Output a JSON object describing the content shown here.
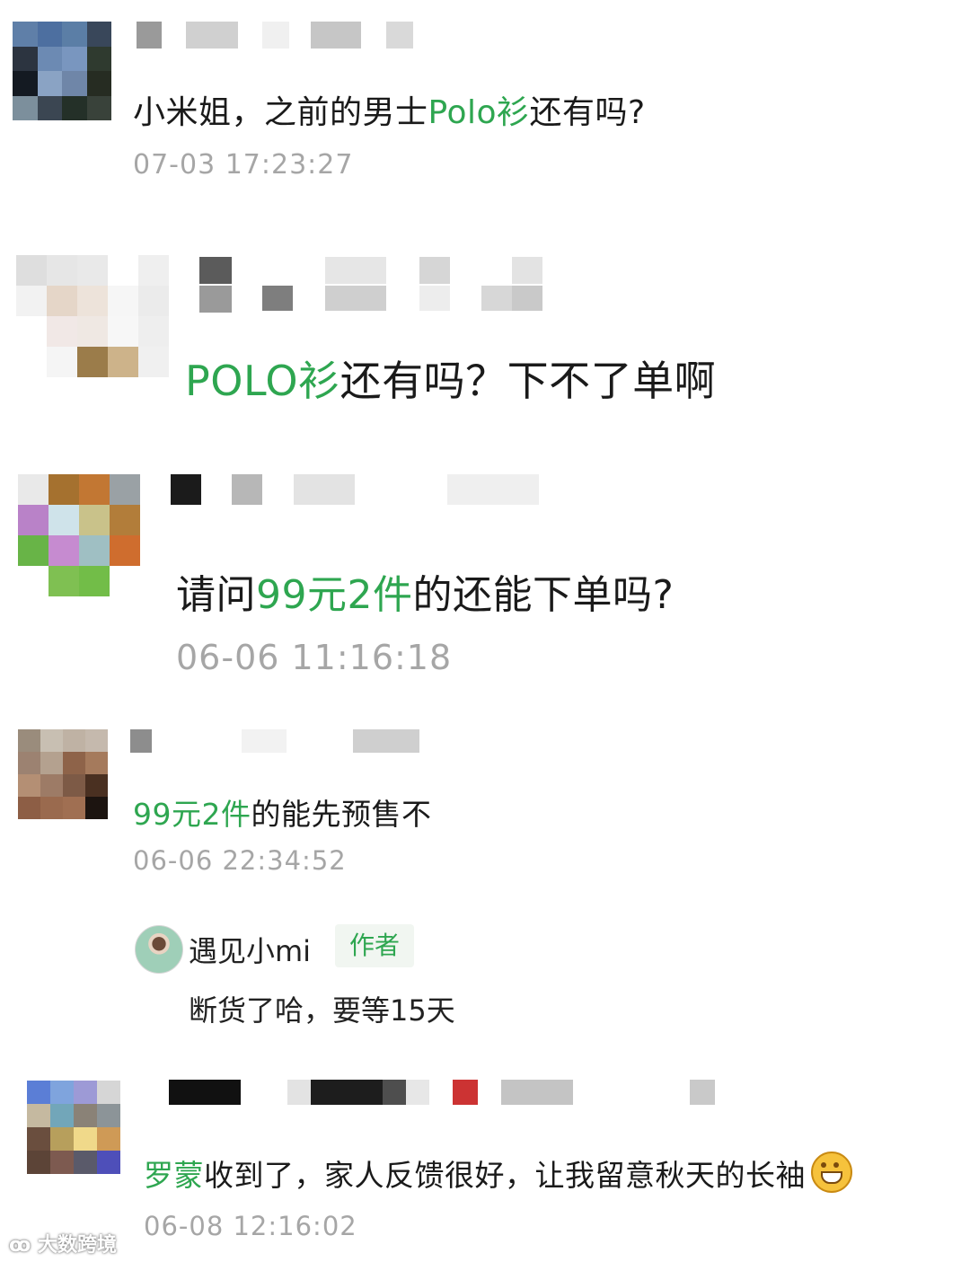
{
  "comments": [
    {
      "parts": [
        {
          "text": "小米姐，之前的男士",
          "highlight": false
        },
        {
          "text": "Polo衫",
          "highlight": true
        },
        {
          "text": "还有吗?",
          "highlight": false
        }
      ],
      "time": "07-03 17:23:27"
    },
    {
      "parts": [
        {
          "text": "POLO衫",
          "highlight": true
        },
        {
          "text": "还有吗？下不了单啊",
          "highlight": false
        }
      ]
    },
    {
      "parts": [
        {
          "text": "请问",
          "highlight": false
        },
        {
          "text": "99元2件",
          "highlight": true
        },
        {
          "text": "的还能下单吗?",
          "highlight": false
        }
      ],
      "time": "06-06 11:16:18"
    },
    {
      "parts": [
        {
          "text": "99元2件",
          "highlight": true
        },
        {
          "text": "的能先预售不",
          "highlight": false
        }
      ],
      "time": "06-06 22:34:52",
      "reply": {
        "author": "遇见小mi",
        "badge": "作者",
        "text": "断货了哈，要等15天"
      }
    },
    {
      "parts": [
        {
          "text": "罗蒙",
          "highlight": true
        },
        {
          "text": "收到了，家人反馈很好，让我留意秋天的长袖",
          "highlight": false
        }
      ],
      "emoji": "grinning-emoji",
      "time": "06-08 12:16:02"
    }
  ],
  "watermark": "大数跨境",
  "colors": {
    "highlight": "#2ea650",
    "timestamp": "#a6a6a6",
    "badge_bg": "#f1f6f1"
  }
}
